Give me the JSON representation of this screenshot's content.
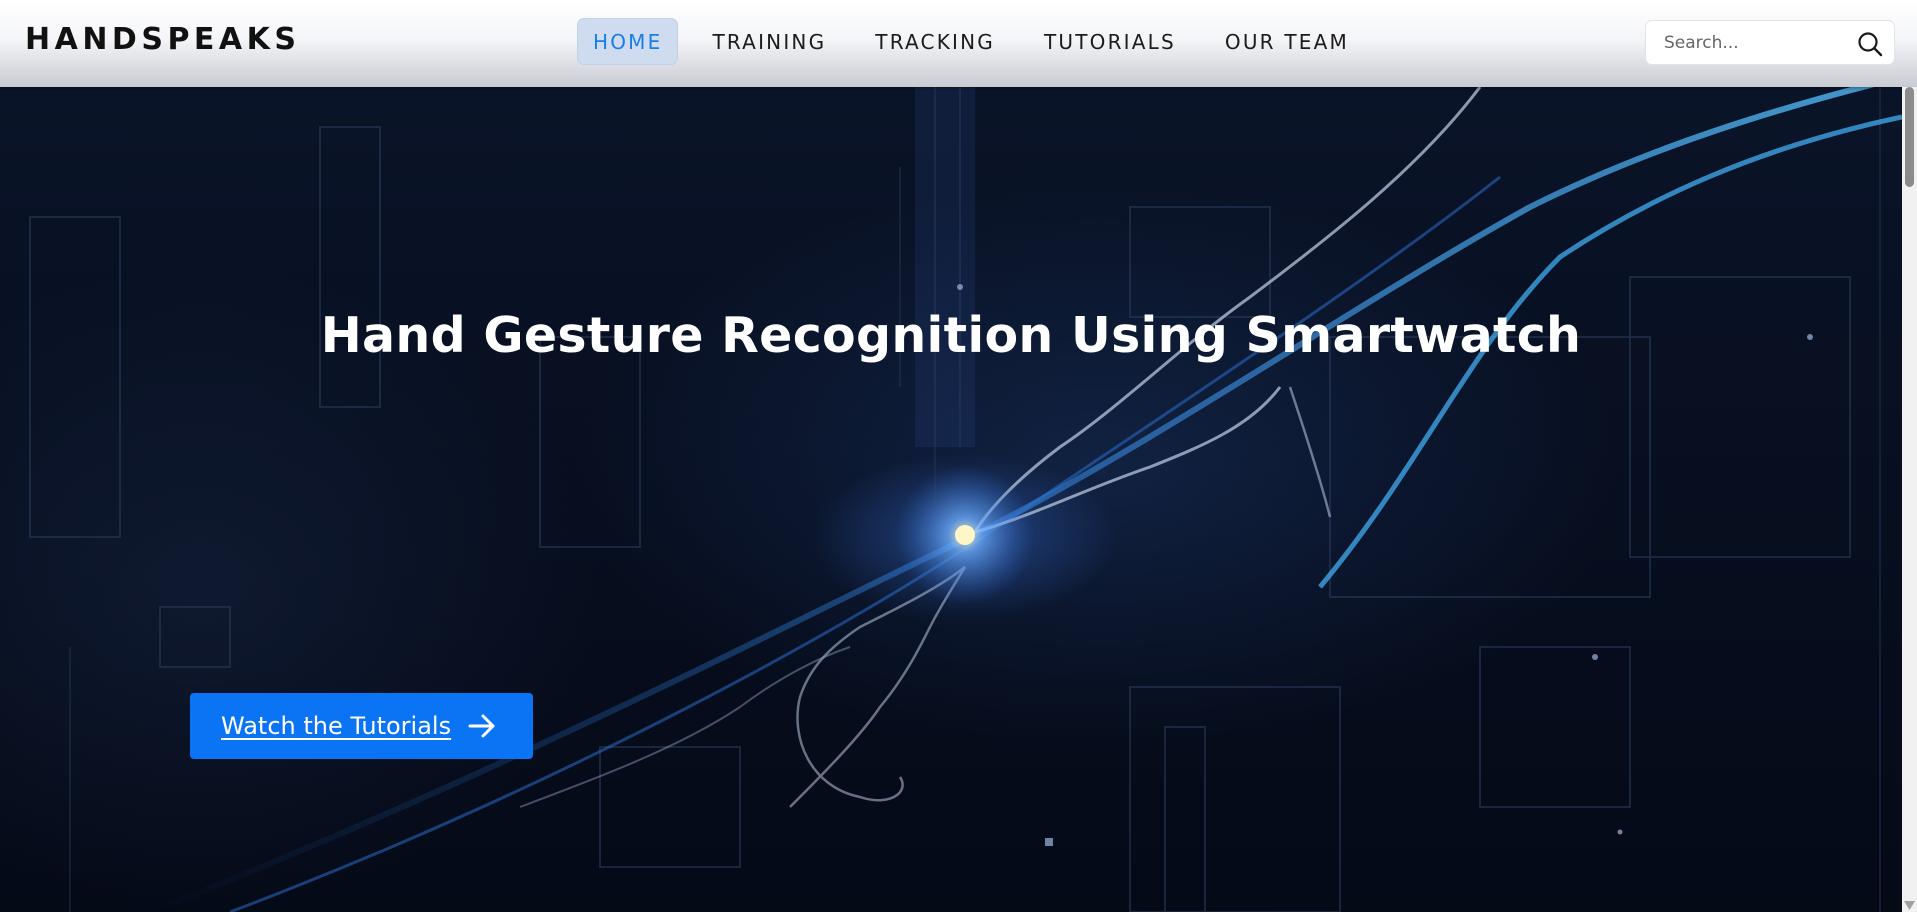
{
  "brand": {
    "name": "HANDSPEAKS"
  },
  "nav": {
    "items": [
      {
        "label": "HOME",
        "active": true
      },
      {
        "label": "TRAINING",
        "active": false
      },
      {
        "label": "TRACKING",
        "active": false
      },
      {
        "label": "TUTORIALS",
        "active": false
      },
      {
        "label": "OUR TEAM",
        "active": false
      }
    ]
  },
  "search": {
    "placeholder": "Search...",
    "value": "",
    "icon": "search-icon"
  },
  "hero": {
    "title": "Hand Gesture Recognition Using Smartwatch",
    "cta_label": "Watch the Tutorials",
    "cta_icon": "arrow-right-icon"
  },
  "colors": {
    "accent": "#0b74f5",
    "active_nav_text": "#1b7ee8",
    "active_nav_bg": "#cfdcf0",
    "hero_bg": "#070e1f",
    "hero_text": "#ffffff"
  }
}
